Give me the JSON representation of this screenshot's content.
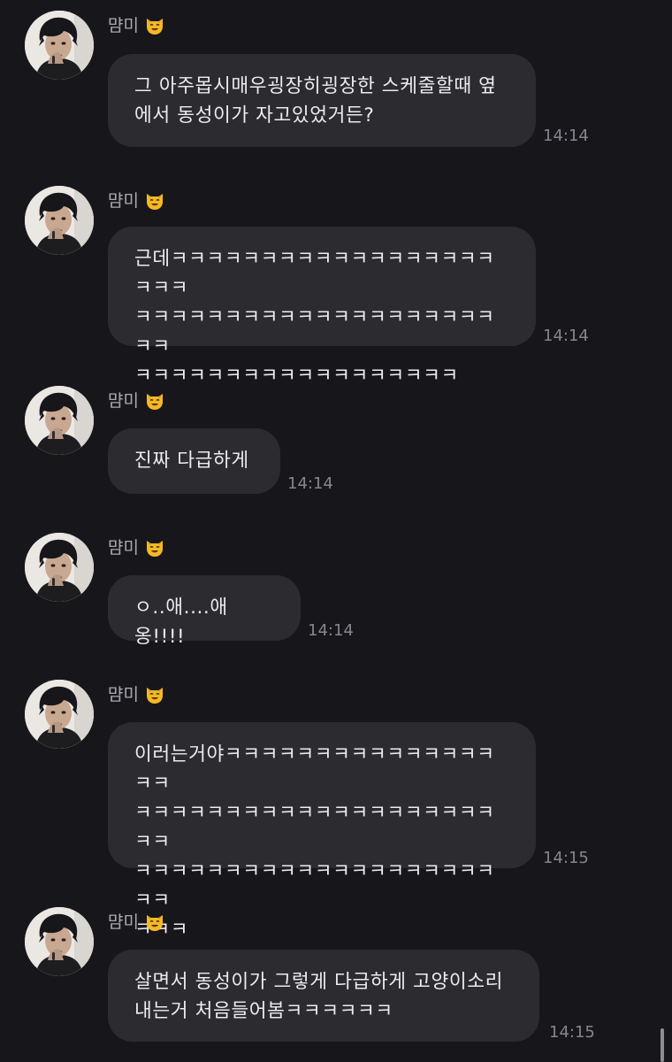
{
  "messages": [
    {
      "sender": "먐미",
      "text": "그 아주몹시매우굉장히굉장한 스케줄할때 옆\n에서 동성이가 자고있었거든?",
      "time": "14:14"
    },
    {
      "sender": "먐미",
      "text": "근데ㅋㅋㅋㅋㅋㅋㅋㅋㅋㅋㅋㅋㅋㅋㅋㅋㅋㅋㅋㅋㅋ\nㅋㅋㅋㅋㅋㅋㅋㅋㅋㅋㅋㅋㅋㅋㅋㅋㅋㅋㅋㅋㅋㅋ\nㅋㅋㅋㅋㅋㅋㅋㅋㅋㅋㅋㅋㅋㅋㅋㅋㅋㅋ",
      "time": "14:14"
    },
    {
      "sender": "먐미",
      "text": "진짜 다급하게",
      "time": "14:14"
    },
    {
      "sender": "먐미",
      "text": "ㅇ..애....애옹!!!!",
      "time": "14:14"
    },
    {
      "sender": "먐미",
      "text": "이러는거야ㅋㅋㅋㅋㅋㅋㅋㅋㅋㅋㅋㅋㅋㅋㅋㅋㅋ\nㅋㅋㅋㅋㅋㅋㅋㅋㅋㅋㅋㅋㅋㅋㅋㅋㅋㅋㅋㅋㅋㅋ\nㅋㅋㅋㅋㅋㅋㅋㅋㅋㅋㅋㅋㅋㅋㅋㅋㅋㅋㅋㅋㅋㅋ\nㅋㅋㅋ",
      "time": "14:15"
    },
    {
      "sender": "먐미",
      "text": "살면서 동성이가 그렇게 다급하게 고양이소리\n내는거 처음들어봄ㅋㅋㅋㅋㅋㅋ",
      "time": "14:15"
    }
  ],
  "colors": {
    "background": "#17171b",
    "bubble": "#2c2c30",
    "time": "#85858c",
    "sender": "#a9a9b0",
    "emoji": "#f5b922"
  },
  "icons": {
    "sender_emoji": "smiling-cat-face-icon"
  }
}
